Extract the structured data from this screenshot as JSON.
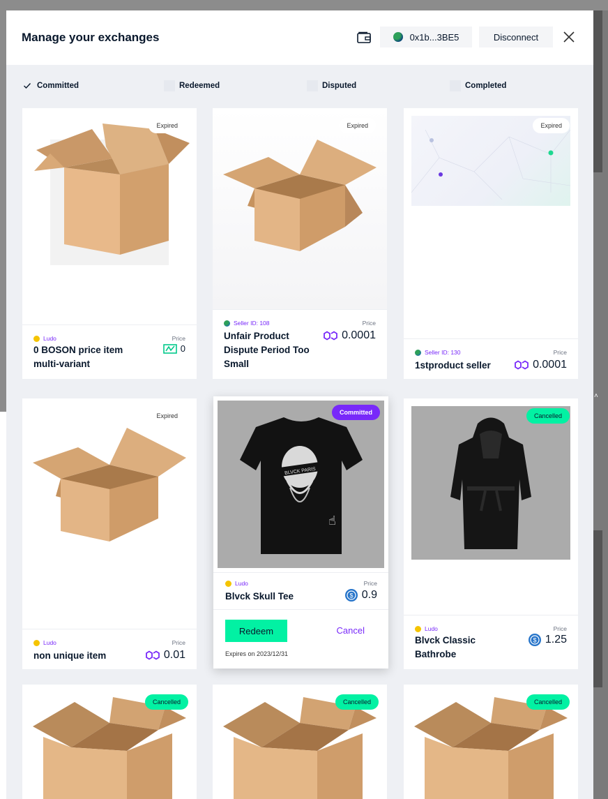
{
  "modal": {
    "title": "Manage your exchanges",
    "wallet_address": "0x1b...3BE5",
    "disconnect_label": "Disconnect"
  },
  "filters": [
    {
      "label": "Committed",
      "checked": true
    },
    {
      "label": "Redeemed",
      "checked": false
    },
    {
      "label": "Disputed",
      "checked": false
    },
    {
      "label": "Completed",
      "checked": false
    }
  ],
  "cards": [
    {
      "badge": "Expired",
      "seller": "Ludo",
      "name": "0 BOSON price item multi-variant",
      "price_label": "Price",
      "price": "0",
      "currency_icon": "boson-icon"
    },
    {
      "badge": "Expired",
      "seller": "Seller ID: 108",
      "name": "Unfair Product Dispute Period Too Small",
      "price_label": "Price",
      "price": "0.0001",
      "currency_icon": "polygon-icon"
    },
    {
      "badge": "Expired",
      "seller": "Seller ID: 130",
      "name": "1stproduct seller",
      "price_label": "Price",
      "price": "0.0001",
      "currency_icon": "polygon-icon"
    },
    {
      "badge": "Expired",
      "seller": "Ludo",
      "name": "non unique item",
      "price_label": "Price",
      "price": "0.01",
      "currency_icon": "polygon-icon"
    },
    {
      "badge": "Committed",
      "seller": "Ludo",
      "name": "Blvck Skull Tee",
      "price_label": "Price",
      "price": "0.9",
      "currency_icon": "usdc-icon",
      "redeem_label": "Redeem",
      "cancel_label": "Cancel",
      "expires": "Expires on 2023/12/31",
      "tee_text": "BLVCK PARIS"
    },
    {
      "badge": "Cancelled",
      "seller": "Ludo",
      "name": "Blvck Classic Bathrobe",
      "price_label": "Price",
      "price": "1.25",
      "currency_icon": "usdc-icon"
    },
    {
      "badge": "Cancelled"
    },
    {
      "badge": "Cancelled"
    },
    {
      "badge": "Cancelled"
    }
  ],
  "colors": {
    "accent": "#7829f9",
    "green": "#02f1a3",
    "text": "#09182c"
  }
}
